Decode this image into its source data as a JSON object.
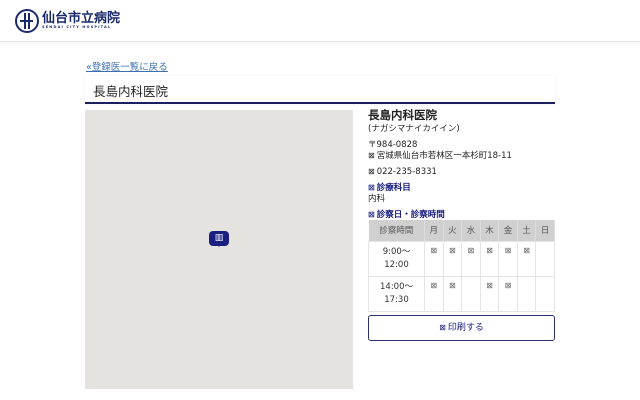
{
  "header": {
    "logo_jp": "仙台市立病院",
    "logo_en": "SENDAI CITY HOSPITAL"
  },
  "back_link": "«登録医一覧に戻る",
  "title": "長島内科医院",
  "map": {
    "pin_icon": "hospital-icon",
    "pin_glyph": "▥"
  },
  "info": {
    "name": "長島内科医院",
    "kana": "(ナガシマナイカイイン)",
    "postal": "〒984-0828",
    "address": "宮城県仙台市若林区一本杉町18-11",
    "phone": "022-235-8331",
    "departments_label": "診療科目",
    "departments": "内科",
    "hours_label": "診察日・診察時間",
    "icon_glyph": "⊠"
  },
  "schedule": {
    "headers": [
      "診察時間",
      "月",
      "火",
      "水",
      "木",
      "金",
      "土",
      "日"
    ],
    "rows": [
      {
        "time1": "9:00〜",
        "time2": "12:00",
        "cells": [
          "⊠",
          "⊠",
          "⊠",
          "⊠",
          "⊠",
          "⊠",
          ""
        ]
      },
      {
        "time1": "14:00〜",
        "time2": "17:30",
        "cells": [
          "⊠",
          "⊠",
          "",
          "⊠",
          "⊠",
          "",
          ""
        ]
      }
    ]
  },
  "print_label": "印刷する"
}
